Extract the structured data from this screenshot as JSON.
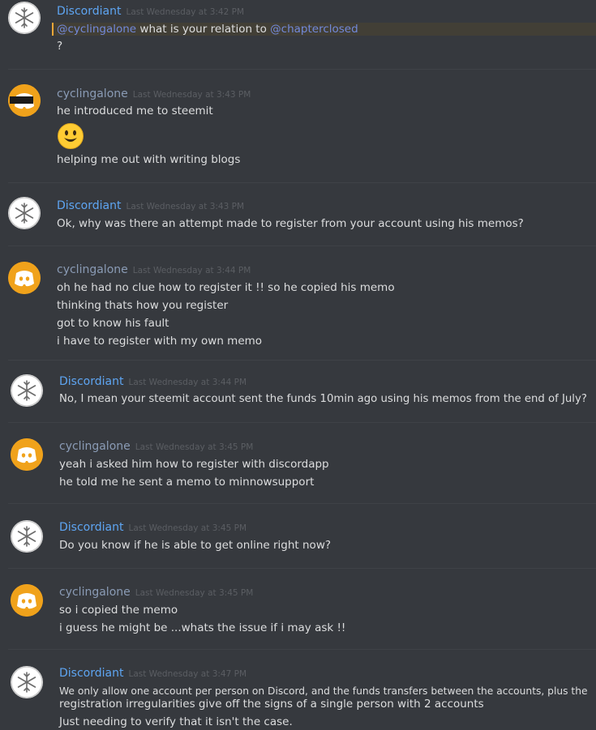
{
  "colors": {
    "background": "#36393e",
    "discordiant_name": "#5ea5f2",
    "user_name": "#8a9bb5",
    "timestamp": "#5b5e63",
    "mention": "#7289da",
    "mention_highlight": "#423f36",
    "mention_bar": "#f2a738",
    "discord_avatar": "#f0a21b"
  },
  "messages": [
    {
      "author": "Discordiant",
      "timestamp": "Last Wednesday at 3:42 PM",
      "avatar_icon": "snowflake-icon",
      "lines": [
        {
          "mention1": "@cyclingalone",
          "text": " what is your relation to ",
          "mention2": "@chapterclosed"
        },
        {
          "text": "?"
        }
      ]
    },
    {
      "author": "cyclingalone",
      "timestamp": "Last Wednesday at 3:43 PM",
      "avatar_icon": "discord-logo-censored-icon",
      "lines": [
        {
          "text": "he introduced me to steemit"
        },
        {
          "emoji": "smiley-emoji-icon"
        },
        {
          "text": "helping me out with writing blogs"
        }
      ]
    },
    {
      "author": "Discordiant",
      "timestamp": "Last Wednesday at 3:43 PM",
      "avatar_icon": "snowflake-icon",
      "lines": [
        {
          "text": "Ok, why was there an attempt made to register from your account using his memos?"
        }
      ]
    },
    {
      "author": "cyclingalone",
      "timestamp": "Last Wednesday at 3:44 PM",
      "avatar_icon": "discord-logo-icon",
      "lines": [
        {
          "text": "oh he had no clue how to register it !! so he copied his memo"
        },
        {
          "text": "thinking thats how you register"
        },
        {
          "text": "got to know his fault"
        },
        {
          "text": "i have to register with my own memo"
        }
      ]
    },
    {
      "author": "Discordiant",
      "timestamp": "Last Wednesday at 3:44 PM",
      "avatar_icon": "snowflake-icon",
      "lines": [
        {
          "text": "No, I mean your steemit account sent the funds 10min ago using his memos from the end of July?"
        }
      ]
    },
    {
      "author": "cyclingalone",
      "timestamp": "Last Wednesday at 3:45 PM",
      "avatar_icon": "discord-logo-icon",
      "lines": [
        {
          "text": "yeah i asked him how to register with discordapp"
        },
        {
          "text": "he told me he sent a memo to minnowsupport"
        }
      ]
    },
    {
      "author": "Discordiant",
      "timestamp": "Last Wednesday at 3:45 PM",
      "avatar_icon": "snowflake-icon",
      "lines": [
        {
          "text": "Do you know if he is able to get online right now?"
        }
      ]
    },
    {
      "author": "cyclingalone",
      "timestamp": "Last Wednesday at 3:45 PM",
      "avatar_icon": "discord-logo-icon",
      "lines": [
        {
          "text": "so i copied the memo"
        },
        {
          "text": "i guess he might be ...whats the issue if i may ask !!"
        }
      ]
    },
    {
      "author": "Discordiant",
      "timestamp": "Last Wednesday at 3:47 PM",
      "avatar_icon": "snowflake-icon",
      "lines": [
        {
          "text": "We only allow one account per person on Discord, and the funds transfers between the accounts, plus the"
        },
        {
          "text": "registration irregularities give off the signs of a single person with 2 accounts"
        },
        {
          "text": "Just needing to verify that it isn't the case."
        }
      ]
    }
  ]
}
